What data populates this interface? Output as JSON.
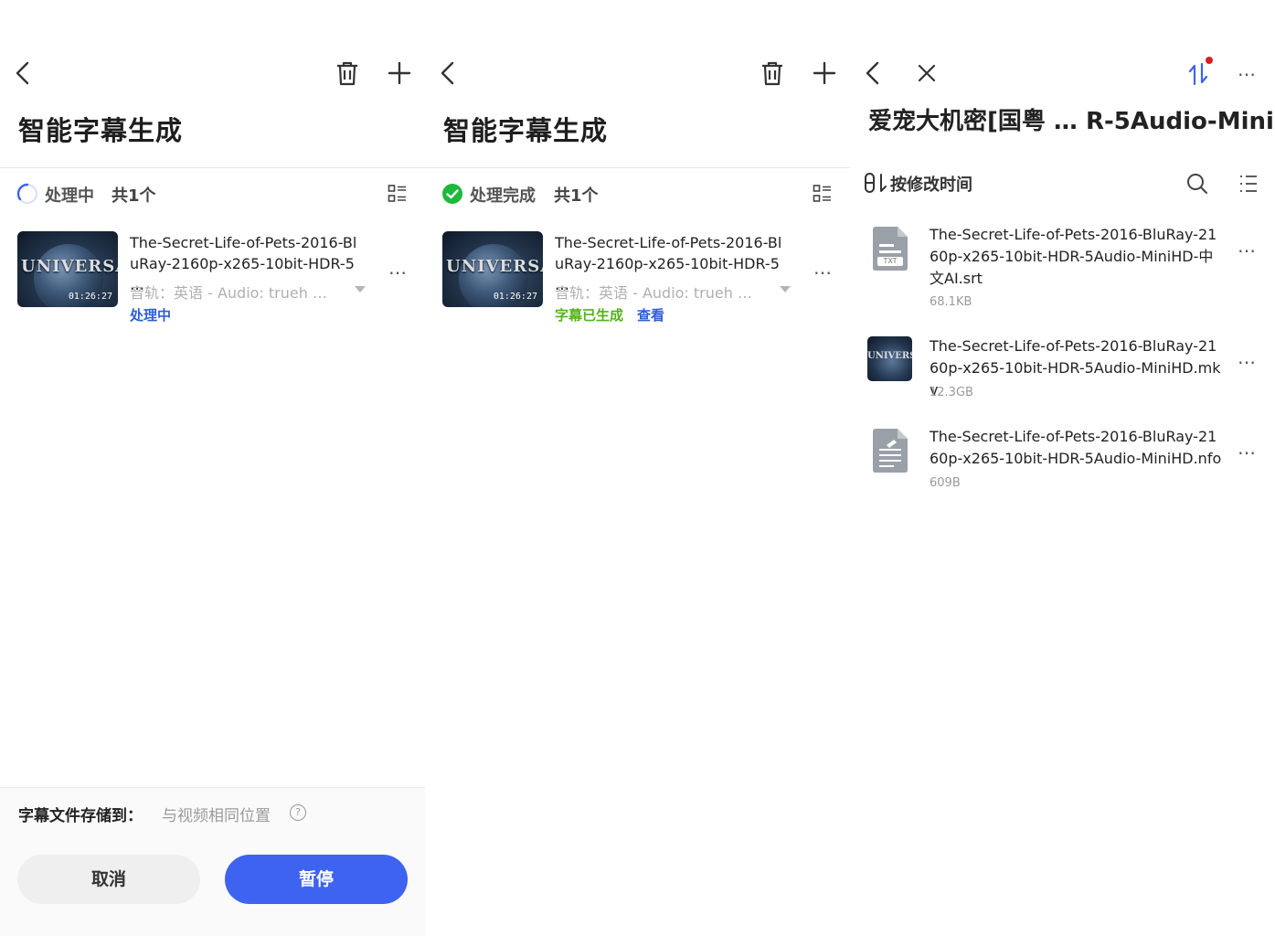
{
  "colors": {
    "accent_blue": "#3d63f0",
    "link_blue": "#2f5fd6",
    "success_green": "#52b416",
    "check_green": "#1db83c",
    "notification_red": "#d81e1e"
  },
  "panel1": {
    "title": "智能字幕生成",
    "status": "处理中",
    "count": "共1个",
    "file": {
      "thumb_logo": "UNIVERSAL",
      "duration": "01:26:27",
      "name": "The-Secret-Life-of-Pets-2016-BluRay-2160p-x265-10bit-HDR-5 …",
      "audio": "音轨：英语 - Audio: trueh …",
      "status": "处理中"
    },
    "more": "…",
    "save_to_label": "字幕文件存储到：",
    "save_to_value": "与视频相同位置",
    "help": "?",
    "cancel_button": "取消",
    "pause_button": "暂停"
  },
  "panel2": {
    "title": "智能字幕生成",
    "status": "处理完成",
    "count": "共1个",
    "file": {
      "thumb_logo": "UNIVERSAL",
      "duration": "01:26:27",
      "name": "The-Secret-Life-of-Pets-2016-BluRay-2160p-x265-10bit-HDR-5 …",
      "audio": "音轨：英语 - Audio: trueh …",
      "status": "字幕已生成",
      "view_link": "查看"
    },
    "more": "…"
  },
  "panel3": {
    "title": "爱宠大机密[国粤 … R-5Audio-MiniHD",
    "sort_label": "按修改时间",
    "files": [
      {
        "icon": "txt-file-icon",
        "badge": "TXT",
        "name": "The-Secret-Life-of-Pets-2016-BluRay-2160p-x265-10bit-HDR-5Audio-MiniHD-中文AI.srt",
        "size": "68.1KB"
      },
      {
        "icon": "video-thumbnail",
        "badge": "UNIVERSAL",
        "name": "The-Secret-Life-of-Pets-2016-BluRay-2160p-x265-10bit-HDR-5Audio-MiniHD.mkv",
        "size": "12.3GB"
      },
      {
        "icon": "document-file-icon",
        "badge": "",
        "name": "The-Secret-Life-of-Pets-2016-BluRay-2160p-x265-10bit-HDR-5Audio-MiniHD.nfo",
        "size": "609B"
      }
    ],
    "more": "…"
  }
}
